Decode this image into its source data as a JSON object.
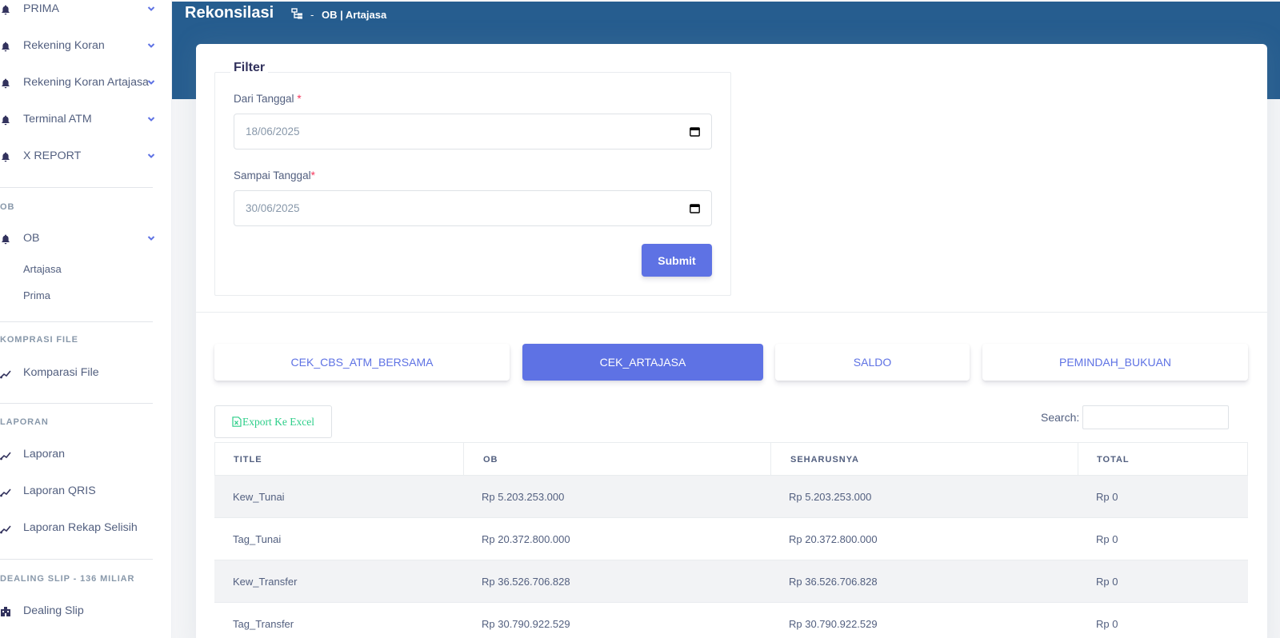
{
  "sidebar": {
    "items_top": [
      {
        "label": "PRIMA"
      },
      {
        "label": "Rekening Koran"
      },
      {
        "label": "Rekening Koran Artajasa"
      },
      {
        "label": "Terminal ATM"
      },
      {
        "label": "X REPORT"
      }
    ],
    "section_ob": "OB",
    "ob_item": {
      "label": "OB"
    },
    "ob_sub": [
      "Artajasa",
      "Prima"
    ],
    "section_komparasi": "KOMPRASI FILE",
    "komparasi_item": {
      "label": "Komparasi File"
    },
    "section_laporan": "LAPORAN",
    "laporan_items": [
      {
        "label": "Laporan"
      },
      {
        "label": "Laporan QRIS"
      },
      {
        "label": "Laporan Rekap Selisih"
      }
    ],
    "section_dealing": "DEALING SLIP - 136 MILIAR",
    "dealing_item": {
      "label": "Dealing Slip"
    }
  },
  "header": {
    "title": "Rekonsilasi",
    "crumb_sep": "-",
    "crumb": "OB | Artajasa"
  },
  "filter": {
    "legend": "Filter",
    "from_label": "Dari Tanggal ",
    "from_value": "18/06/2025",
    "to_label": "Sampai Tanggal",
    "to_value": "30/06/2025",
    "required_mark": "*",
    "submit_label": "Submit"
  },
  "tabs": [
    {
      "label": "CEK_CBS_ATM_BERSAMA",
      "active": false
    },
    {
      "label": "CEK_ARTAJASA",
      "active": true
    },
    {
      "label": "SALDO",
      "active": false
    },
    {
      "label": "PEMINDAH_BUKUAN",
      "active": false
    }
  ],
  "table_controls": {
    "export_label": "Export Ke Excel",
    "search_label": "Search:",
    "search_value": ""
  },
  "table": {
    "columns": [
      "TITLE",
      "OB",
      "SEHARUSNYA",
      "TOTAL"
    ],
    "rows": [
      [
        "Kew_Tunai",
        "Rp 5.203.253.000",
        "Rp 5.203.253.000",
        "Rp 0"
      ],
      [
        "Tag_Tunai",
        "Rp 20.372.800.000",
        "Rp 20.372.800.000",
        "Rp 0"
      ],
      [
        "Kew_Transfer",
        "Rp 36.526.706.828",
        "Rp 36.526.706.828",
        "Rp 0"
      ],
      [
        "Tag_Transfer",
        "Rp 30.790.922.529",
        "Rp 30.790.922.529",
        "Rp 0"
      ]
    ]
  },
  "colors": {
    "header_bg": "#265d8f",
    "primary": "#5e72e4",
    "excel_green": "#2dce89"
  }
}
